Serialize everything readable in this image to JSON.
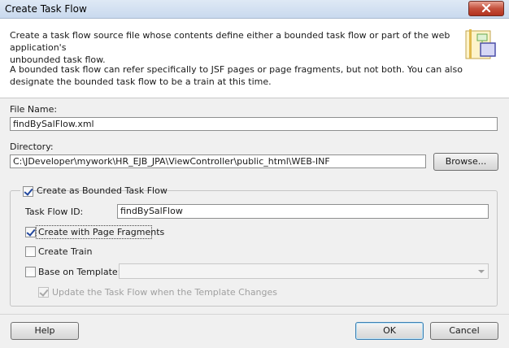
{
  "window": {
    "title": "Create Task Flow",
    "close_label": "close"
  },
  "header": {
    "description_1": "Create a task flow source file whose contents define either a bounded task flow or part of the web application's\nunbounded task flow.",
    "description_2": "A bounded task flow can refer specifically to JSF pages or page fragments, but not both.  You can also\ndesignate the bounded task flow to be a train at this time.",
    "icon": "task-flow-wizard-icon"
  },
  "form": {
    "file_name_label": "File Name:",
    "file_name_value": "findBySalFlow.xml",
    "directory_label": "Directory:",
    "directory_value": "C:\\JDeveloper\\mywork\\HR_EJB_JPA\\ViewController\\public_html\\WEB-INF",
    "browse_label": "Browse..."
  },
  "bounded": {
    "create_bounded_label": "Create as Bounded Task Flow",
    "create_bounded_checked": true,
    "task_flow_id_label": "Task Flow ID:",
    "task_flow_id_value": "findBySalFlow",
    "page_fragments_label": "Create with Page Fragments",
    "page_fragments_checked": true,
    "create_train_label": "Create Train",
    "create_train_checked": false,
    "base_on_template_label": "Base on Template:",
    "base_on_template_checked": false,
    "template_value": "",
    "update_label": "Update the Task Flow when the Template Changes",
    "update_checked": true
  },
  "footer": {
    "help_label": "Help",
    "ok_label": "OK",
    "cancel_label": "Cancel"
  }
}
